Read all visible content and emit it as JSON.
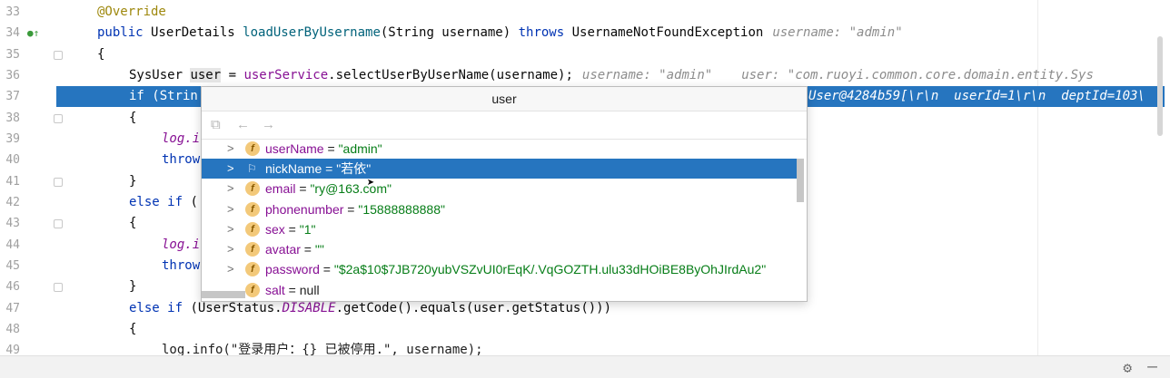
{
  "editor": {
    "line_numbers": [
      "33",
      "34",
      "35",
      "36",
      "37",
      "38",
      "39",
      "40",
      "41",
      "42",
      "43",
      "44",
      "45",
      "46",
      "47",
      "48",
      "49"
    ],
    "lines": {
      "l33": "@Override",
      "l34_kw": "public",
      "l34_type": " UserDetails ",
      "l34_fn": "loadUserByUsername",
      "l34_args": "(String username) ",
      "l34_throws": "throws",
      "l34_ex": " UsernameNotFoundException",
      "l34_hint": "username: \"admin\"",
      "l35": "{",
      "l36_a": "SysUser ",
      "l36_var": "user",
      "l36_b": " = ",
      "l36_svc": "userService",
      "l36_c": ".selectUserByUserName(username);",
      "l36_hint1": "username: \"admin\"",
      "l36_hint2": "user: \"com.ruoyi.common.core.domain.entity.Sys",
      "l37_kw": "if",
      "l37_rest": " (Strin",
      "l37_hint": "User@4284b59[\\r\\n  userId=1\\r\\n  deptId=103\\",
      "l38": "{",
      "l39": "log.i",
      "l40": "throw",
      "l41": "}",
      "l42_kw": "else if",
      "l42_rest": " (",
      "l43": "{",
      "l44": "log.i",
      "l45": "throw",
      "l46": "}",
      "l47_kw": "else if",
      "l47_a": " (UserStatus.",
      "l47_it": "DISABLE",
      "l47_b": ".getCode().equals(user.getStatus()))",
      "l48": "{",
      "l49": "log.info(\"登录用户：{} 已被停用.\", username);"
    }
  },
  "popup": {
    "title": "user",
    "fields": [
      {
        "name": "userName",
        "value": "\"admin\""
      },
      {
        "name": "nickName",
        "value": "\"若依\""
      },
      {
        "name": "email",
        "value": "\"ry@163.com\""
      },
      {
        "name": "phonenumber",
        "value": "\"15888888888\""
      },
      {
        "name": "sex",
        "value": "\"1\""
      },
      {
        "name": "avatar",
        "value": "\"\""
      },
      {
        "name": "password",
        "value": "\"$2a$10$7JB720yubVSZvUI0rEqK/.VqGOZTH.ulu33dHOiBE8ByOhJIrdAu2\""
      },
      {
        "name": "salt",
        "value": "null"
      }
    ],
    "selected_index": 1,
    "field_icon_letter": "f",
    "equals": " = "
  },
  "icons": [
    "override-marker-icon",
    "copy-icon",
    "back-arrow-icon",
    "forward-arrow-icon",
    "gear-icon",
    "minimize-icon",
    "expand-arrow-icon",
    "field-icon",
    "watch-flag-icon",
    "mouse-cursor-icon"
  ],
  "colors": {
    "selection": "#2675bf",
    "keyword": "#0033b3",
    "string": "#067d17",
    "field": "#871094"
  }
}
